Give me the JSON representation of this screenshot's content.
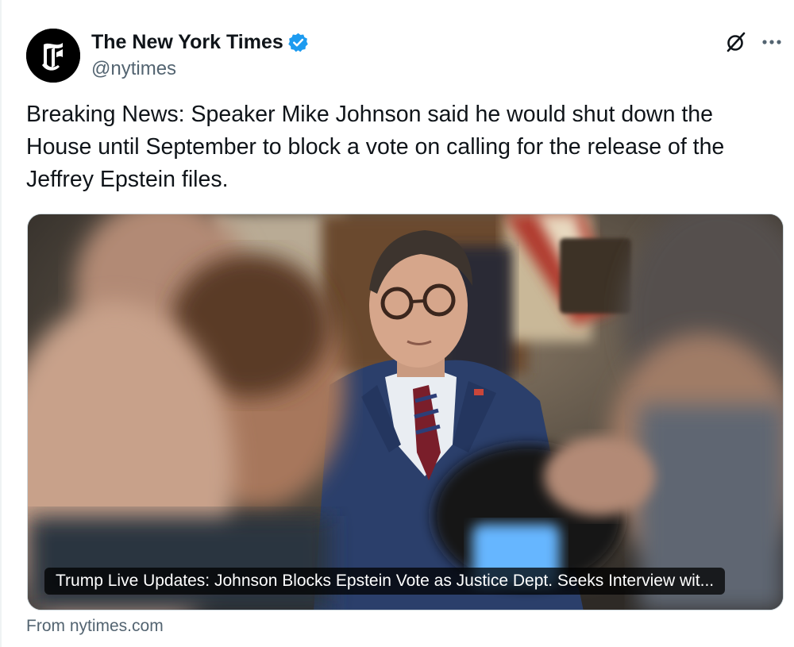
{
  "author": {
    "display_name": "The New York Times",
    "handle": "@nytimes",
    "avatar_icon": "nyt-logo-icon",
    "verified_icon": "verified-badge-icon"
  },
  "header_actions": {
    "grok_icon": "grok-icon",
    "more_icon": "more-horizontal-icon"
  },
  "tweet": {
    "text": "Breaking News: Speaker Mike Johnson said he would shut down the\nHouse until September to block a vote on calling for the release of the\nJeffrey Epstein files."
  },
  "link_card": {
    "headline": "Trump Live Updates: Johnson Blocks Epstein Vote as Justice Dept. Seeks Interview wit...",
    "source": "From nytimes.com"
  },
  "colors": {
    "text_primary": "#0f1419",
    "text_secondary": "#536471",
    "verified_blue": "#1d9bf0",
    "card_border": "#cfd9de"
  }
}
